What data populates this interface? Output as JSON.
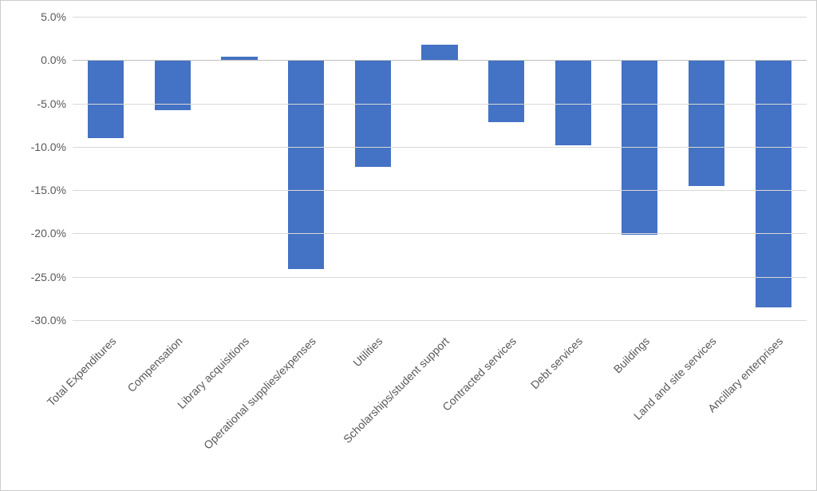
{
  "chart_data": {
    "type": "bar",
    "categories": [
      "Total Expenditures",
      "Compensation",
      "Library acquisitions",
      "Operational supplies/expenses",
      "Utilities",
      "Scholarships/student support",
      "Contracted services",
      "Debt services",
      "Buildings",
      "Land and site services",
      "Ancillary enterprises"
    ],
    "values": [
      -9.0,
      -5.8,
      0.4,
      -24.1,
      -12.3,
      1.8,
      -7.2,
      -9.8,
      -20.1,
      -14.5,
      -28.5
    ],
    "title": "",
    "xlabel": "",
    "ylabel": "",
    "ylim": [
      -30.0,
      5.0
    ],
    "yticks": [
      5.0,
      0.0,
      -5.0,
      -10.0,
      -15.0,
      -20.0,
      -25.0,
      -30.0
    ],
    "ytick_labels": [
      "5.0%",
      "0.0%",
      "-5.0%",
      "-10.0%",
      "-15.0%",
      "-20.0%",
      "-25.0%",
      "-30.0%"
    ],
    "bar_color": "#4472c4",
    "grid_color": "#d9d9d9"
  }
}
